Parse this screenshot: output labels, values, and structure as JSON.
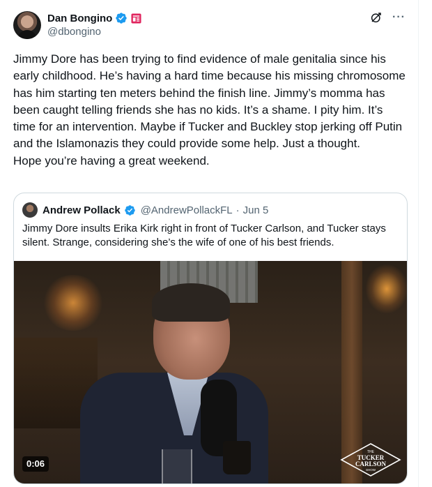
{
  "tweet": {
    "author": {
      "display_name": "Dan Bongino",
      "handle": "@dbongino",
      "verified": true,
      "badge_color": "#e0245e"
    },
    "text": "Jimmy Dore has been trying to find evidence of male genitalia since his early childhood. He’s having a hard time because his missing chromosome has him starting ten meters behind the finish line. Jimmy’s momma has been caught telling friends she has no kids. It’s a shame. I pity him. It’s time for an intervention. Maybe if Tucker and Buckley stop jerking off Putin and the Islamonazis they could provide some help. Just a thought.\nHope you’re having a great weekend.",
    "actions": {
      "grok_icon": "grok-icon",
      "more_icon": "more-icon",
      "more_label": "···"
    }
  },
  "quote": {
    "author": {
      "display_name": "Andrew Pollack",
      "handle": "@AndrewPollackFL",
      "separator": "·",
      "date": "Jun 5",
      "verified": true
    },
    "text": "Jimmy Dore insults Erika Kirk right in front of Tucker Carlson, and Tucker stays silent. Strange, considering she’s the wife of one of his best friends.",
    "video": {
      "duration": "0:06",
      "logo_line1": "THE",
      "logo_line2": "TUCKER",
      "logo_line3": "CARLSON",
      "logo_line4": "SHOW"
    }
  },
  "colors": {
    "text_primary": "#0f1419",
    "text_secondary": "#536471",
    "verified_blue": "#1d9bf0",
    "border": "#cfd9de"
  }
}
